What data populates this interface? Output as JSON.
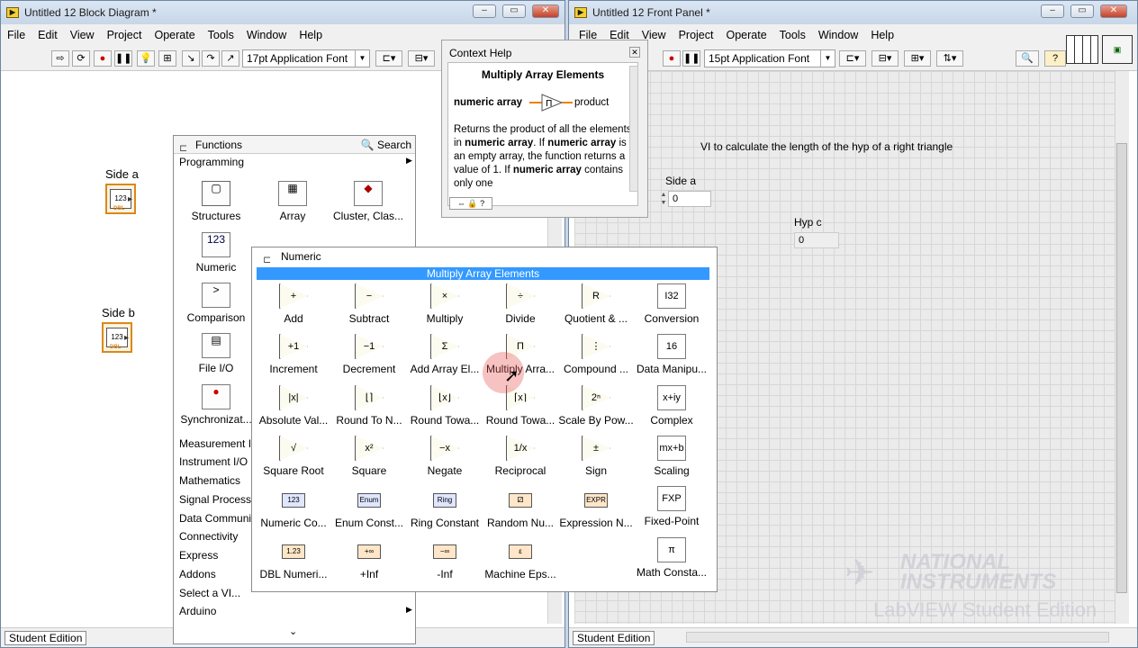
{
  "block_diagram": {
    "title": "Untitled 12 Block Diagram *",
    "menu": [
      "File",
      "Edit",
      "View",
      "Project",
      "Operate",
      "Tools",
      "Window",
      "Help"
    ],
    "font_select": "17pt Application Font",
    "terminals": [
      {
        "label": "Side a",
        "type": "123",
        "sub": "DBL"
      },
      {
        "label": "Side b",
        "type": "123",
        "sub": "DBL"
      }
    ],
    "status": "Student Edition"
  },
  "front_panel": {
    "title": "Untitled 12 Front Panel *",
    "menu": [
      "File",
      "Edit",
      "View",
      "Project",
      "Operate",
      "Tools",
      "Window",
      "Help"
    ],
    "font_select": "15pt Application Font",
    "description": "VI to calculate the length of the hyp of a right triangle",
    "side_a": {
      "label": "Side a",
      "value": "0"
    },
    "hyp_c": {
      "label": "Hyp c",
      "value": "0"
    },
    "status": "Student Edition",
    "watermark_line1": "NATIONAL",
    "watermark_line2": "INSTRUMENTS",
    "watermark_line3": "LabVIEW Student Edition"
  },
  "context_help": {
    "title": "Context Help",
    "heading": "Multiply Array Elements",
    "input": "numeric array",
    "output": "product",
    "desc_1": "Returns the product of all the elements in ",
    "desc_b1": "numeric array",
    "desc_2": ". If ",
    "desc_b2": "numeric array",
    "desc_3": " is an empty array, the function returns a value of 1. If ",
    "desc_b3": "numeric array",
    "desc_4": " contains only one"
  },
  "functions": {
    "title": "Functions",
    "search": "Search",
    "category": "Programming",
    "items": [
      "Structures",
      "Array",
      "Cluster, Clas...",
      "Numeric",
      "Comparison",
      "File I/O",
      "Synchronizat..."
    ],
    "subcategories": [
      "Measurement I",
      "Instrument I/O",
      "Mathematics",
      "Signal Processi",
      "Data Communi",
      "Connectivity",
      "Express",
      "Addons",
      "Select a VI...",
      "Arduino"
    ]
  },
  "numeric": {
    "title": "Numeric",
    "selected": "Multiply Array Elements",
    "items": [
      "Add",
      "Subtract",
      "Multiply",
      "Divide",
      "Quotient & ...",
      "Conversion",
      "Increment",
      "Decrement",
      "Add Array El...",
      "Multiply Arra...",
      "Compound ...",
      "Data Manipu...",
      "Absolute Val...",
      "Round To N...",
      "Round Towa...",
      "Round Towa...",
      "Scale By Pow...",
      "Complex",
      "Square Root",
      "Square",
      "Negate",
      "Reciprocal",
      "Sign",
      "Scaling",
      "Numeric Co...",
      "Enum Const...",
      "Ring Constant",
      "Random Nu...",
      "Expression N...",
      "Fixed-Point",
      "DBL Numeri...",
      "+Inf",
      "-Inf",
      "Machine Eps...",
      "",
      "Math Consta..."
    ],
    "glyphs": [
      "+",
      "−",
      "×",
      "÷",
      "R",
      "I32",
      "+1",
      "−1",
      "Σ",
      "Π",
      "⋮",
      "16",
      "|x|",
      "⌊⌉",
      "⌊x⌋",
      "⌈x⌉",
      "2ⁿ",
      "x+iy",
      "√",
      "x²",
      "−x",
      "1/x",
      "±",
      "mx+b",
      "123",
      "Enum",
      "Ring",
      "⚂",
      "EXPR",
      "FXP",
      "1.23",
      "+∞",
      "−∞",
      "ε",
      "",
      "π"
    ]
  }
}
